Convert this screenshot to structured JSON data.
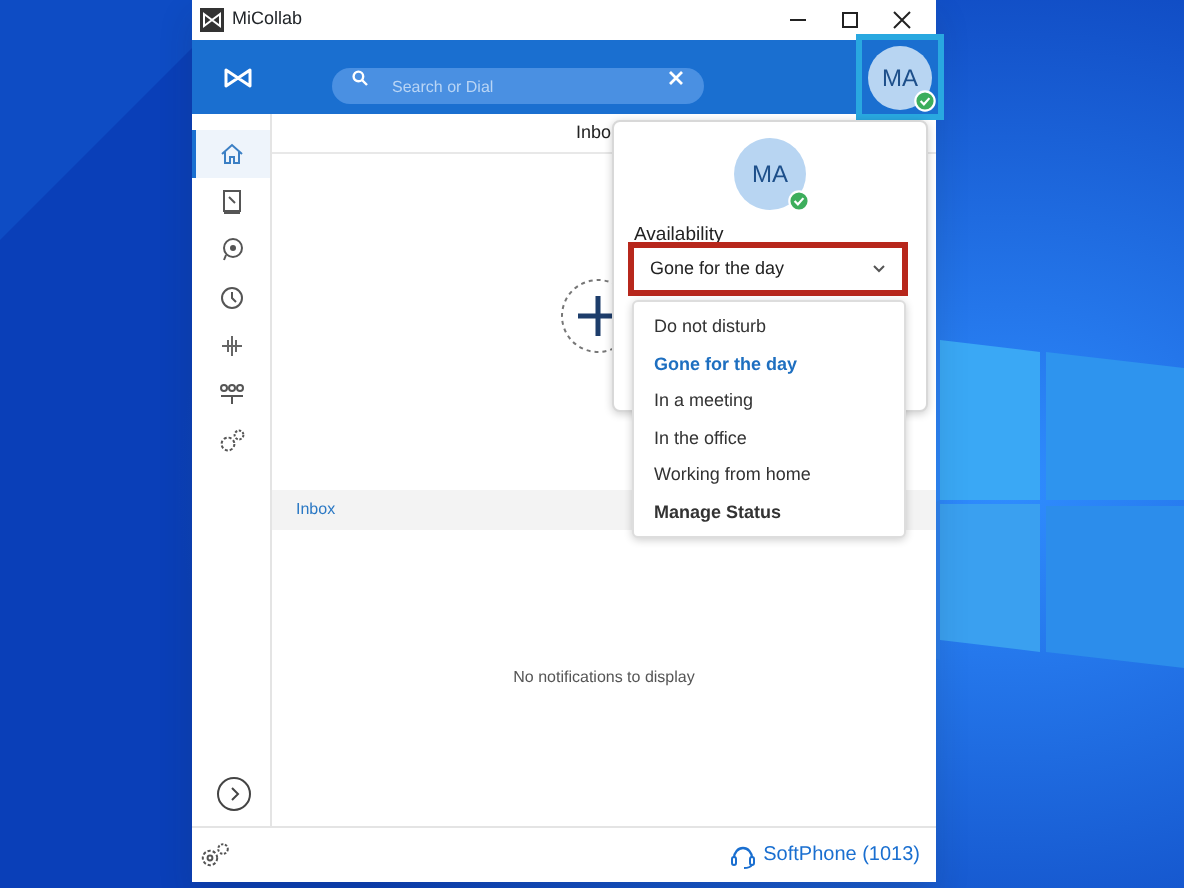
{
  "window": {
    "title": "MiCollab"
  },
  "header": {
    "search": {
      "placeholder": "Search or Dial"
    },
    "avatar": {
      "initials": "MA",
      "online": true,
      "highlighted": true
    }
  },
  "sidebar": {
    "items": [
      {
        "selected": true
      },
      {
        "selected": false
      },
      {
        "selected": false
      },
      {
        "selected": false
      },
      {
        "selected": false
      },
      {
        "selected": false
      },
      {
        "selected": false
      }
    ]
  },
  "content": {
    "heading": "Inbo",
    "inbox_label": "Inbox",
    "empty_message": "No notifications to display"
  },
  "footer": {
    "softphone": "SoftPhone (1013)"
  },
  "availability": {
    "initials": "MA",
    "online": true,
    "label": "Availability",
    "value": "Gone for the day",
    "highlighted": true,
    "options": [
      {
        "label": "Do not disturb",
        "kind": "status",
        "selected": false
      },
      {
        "label": "Gone for the day",
        "kind": "status",
        "selected": true
      },
      {
        "label": "In a meeting",
        "kind": "status",
        "selected": false
      },
      {
        "label": "In the office",
        "kind": "status",
        "selected": false
      },
      {
        "label": "Working from home",
        "kind": "status",
        "selected": false
      },
      {
        "label": "Manage Status",
        "kind": "action"
      }
    ]
  }
}
